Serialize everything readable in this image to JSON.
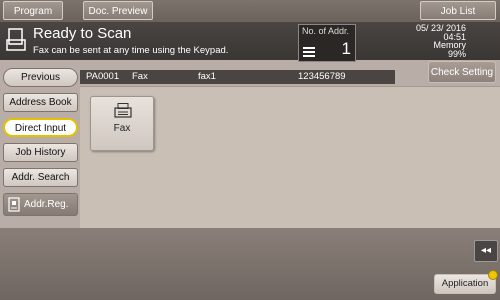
{
  "topbar": {
    "program_label": "Program",
    "doc_preview_label": "Doc. Preview",
    "job_list_label": "Job List"
  },
  "header": {
    "title": "Ready to Scan",
    "message": "Fax can be sent at any time using the Keypad.",
    "addr_label": "No. of Addr.",
    "addr_count": "1",
    "date": "05/ 23/ 2016",
    "time": "04:51",
    "memory_label": "Memory",
    "memory_value": "99%"
  },
  "check_setting_label": "Check Setting",
  "entry": {
    "id": "PA0001",
    "type": "Fax",
    "name": "fax1",
    "number": "123456789"
  },
  "sidebar": {
    "items": [
      {
        "label": "Previous"
      },
      {
        "label": "Address Book"
      },
      {
        "label": "Direct Input"
      },
      {
        "label": "Job History"
      },
      {
        "label": "Addr. Search"
      }
    ],
    "addr_reg_label": "Addr.Reg."
  },
  "panel": {
    "fax_label": "Fax"
  },
  "bottom": {
    "application_label": "Application",
    "rewind_icon": "◂◂"
  },
  "colors": {
    "accent_yellow": "#e4c200",
    "header_dark": "#3a3633"
  }
}
